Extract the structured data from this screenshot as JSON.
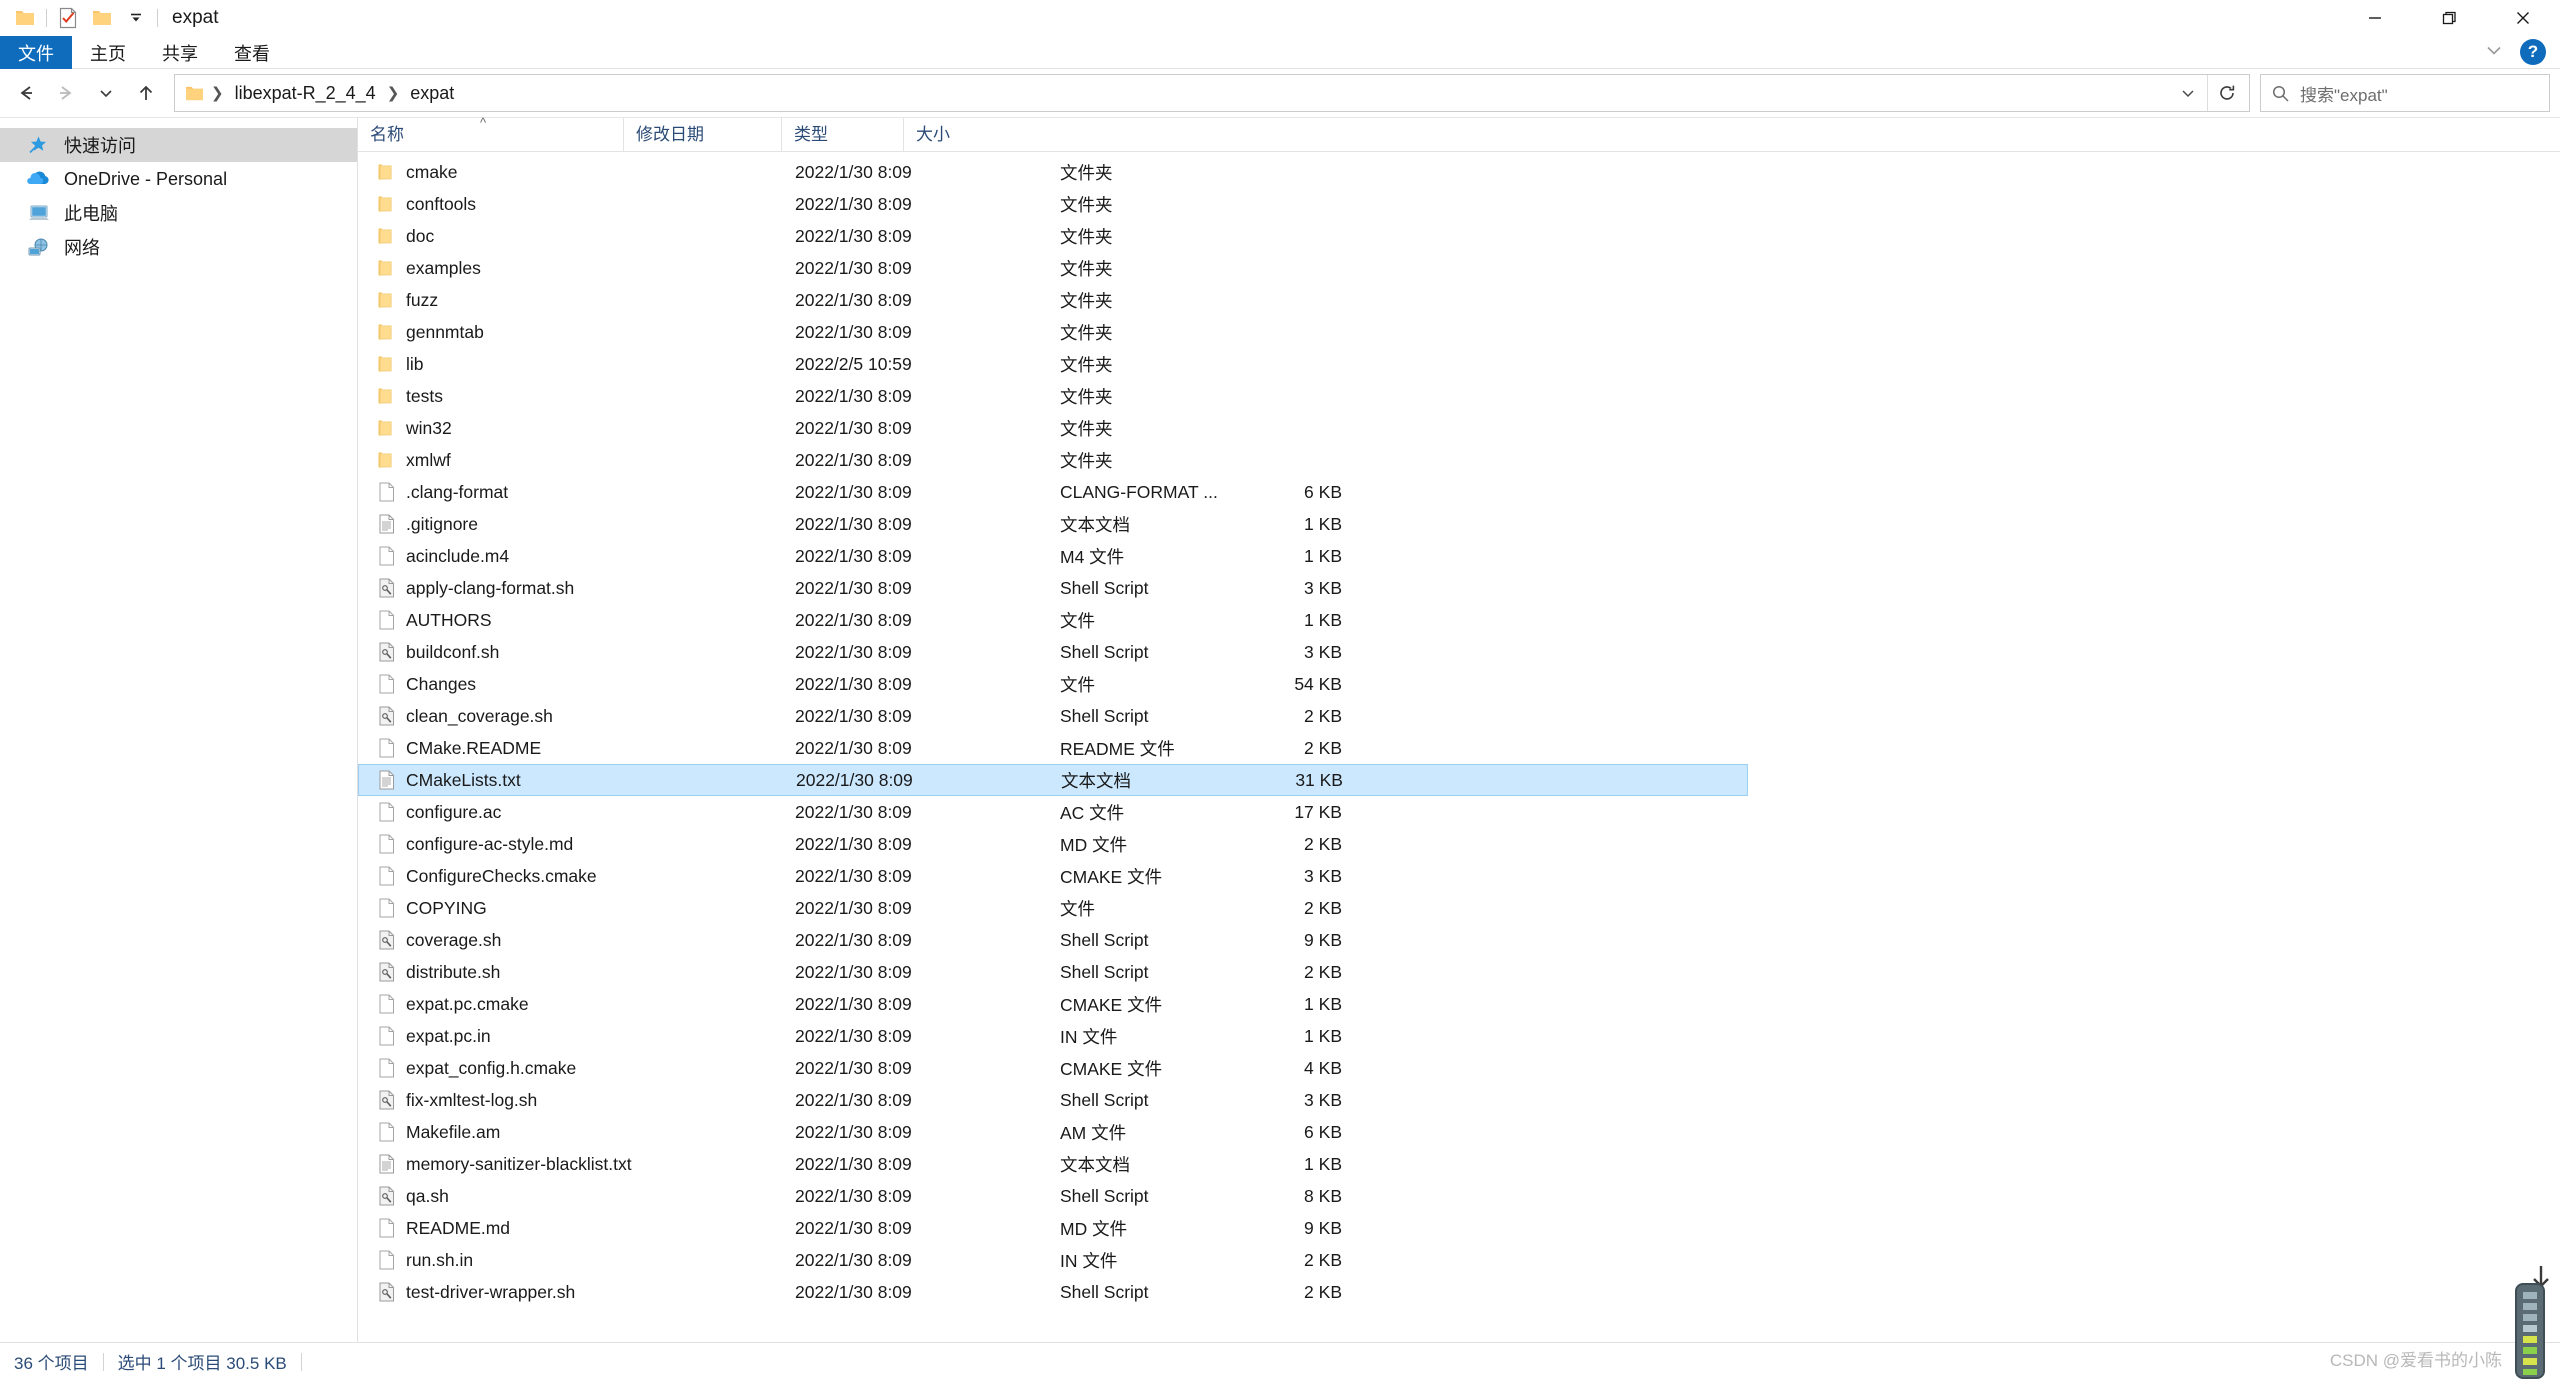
{
  "window": {
    "title": "expat",
    "quick_access": [
      "folder-icon",
      "checklist-icon",
      "folder-icon",
      "dropdown-caret"
    ],
    "controls": {
      "minimize": "minimize-icon",
      "maximize": "restore-icon",
      "close": "close-icon"
    }
  },
  "ribbon": {
    "tabs": [
      {
        "label": "文件",
        "active": true
      },
      {
        "label": "主页",
        "active": false
      },
      {
        "label": "共享",
        "active": false
      },
      {
        "label": "查看",
        "active": false
      }
    ],
    "collapse_label": "⌄",
    "help_label": "?"
  },
  "address": {
    "back": "back-arrow",
    "forward": "forward-arrow",
    "recent": "recent-chevron",
    "up": "up-arrow",
    "breadcrumbs": [
      "libexpat-R_2_4_4",
      "expat"
    ],
    "refresh": "refresh-icon"
  },
  "search": {
    "placeholder": "搜索\"expat\"",
    "icon": "search-icon"
  },
  "sidebar": {
    "items": [
      {
        "label": "快速访问",
        "icon": "pin-star-icon",
        "selected": true
      },
      {
        "label": "OneDrive - Personal",
        "icon": "onedrive-cloud-icon",
        "selected": false
      },
      {
        "label": "此电脑",
        "icon": "this-pc-icon",
        "selected": false
      },
      {
        "label": "网络",
        "icon": "network-icon",
        "selected": false
      }
    ]
  },
  "columns": [
    {
      "key": "name",
      "label": "名称",
      "sorted": "asc"
    },
    {
      "key": "date",
      "label": "修改日期",
      "sorted": ""
    },
    {
      "key": "type",
      "label": "类型",
      "sorted": ""
    },
    {
      "key": "size",
      "label": "大小",
      "sorted": ""
    }
  ],
  "files": [
    {
      "name": "cmake",
      "date": "2022/1/30 8:09",
      "type": "文件夹",
      "size": "",
      "icon": "folder-icon",
      "selected": false
    },
    {
      "name": "conftools",
      "date": "2022/1/30 8:09",
      "type": "文件夹",
      "size": "",
      "icon": "folder-icon",
      "selected": false
    },
    {
      "name": "doc",
      "date": "2022/1/30 8:09",
      "type": "文件夹",
      "size": "",
      "icon": "folder-icon",
      "selected": false
    },
    {
      "name": "examples",
      "date": "2022/1/30 8:09",
      "type": "文件夹",
      "size": "",
      "icon": "folder-icon",
      "selected": false
    },
    {
      "name": "fuzz",
      "date": "2022/1/30 8:09",
      "type": "文件夹",
      "size": "",
      "icon": "folder-icon",
      "selected": false
    },
    {
      "name": "gennmtab",
      "date": "2022/1/30 8:09",
      "type": "文件夹",
      "size": "",
      "icon": "folder-icon",
      "selected": false
    },
    {
      "name": "lib",
      "date": "2022/2/5 10:59",
      "type": "文件夹",
      "size": "",
      "icon": "folder-icon",
      "selected": false
    },
    {
      "name": "tests",
      "date": "2022/1/30 8:09",
      "type": "文件夹",
      "size": "",
      "icon": "folder-icon",
      "selected": false
    },
    {
      "name": "win32",
      "date": "2022/1/30 8:09",
      "type": "文件夹",
      "size": "",
      "icon": "folder-icon",
      "selected": false
    },
    {
      "name": "xmlwf",
      "date": "2022/1/30 8:09",
      "type": "文件夹",
      "size": "",
      "icon": "folder-icon",
      "selected": false
    },
    {
      "name": ".clang-format",
      "date": "2022/1/30 8:09",
      "type": "CLANG-FORMAT ...",
      "size": "6 KB",
      "icon": "file-icon",
      "selected": false
    },
    {
      "name": ".gitignore",
      "date": "2022/1/30 8:09",
      "type": "文本文档",
      "size": "1 KB",
      "icon": "text-icon",
      "selected": false
    },
    {
      "name": "acinclude.m4",
      "date": "2022/1/30 8:09",
      "type": "M4 文件",
      "size": "1 KB",
      "icon": "file-icon",
      "selected": false
    },
    {
      "name": "apply-clang-format.sh",
      "date": "2022/1/30 8:09",
      "type": "Shell Script",
      "size": "3 KB",
      "icon": "script-icon",
      "selected": false
    },
    {
      "name": "AUTHORS",
      "date": "2022/1/30 8:09",
      "type": "文件",
      "size": "1 KB",
      "icon": "file-icon",
      "selected": false
    },
    {
      "name": "buildconf.sh",
      "date": "2022/1/30 8:09",
      "type": "Shell Script",
      "size": "3 KB",
      "icon": "script-icon",
      "selected": false
    },
    {
      "name": "Changes",
      "date": "2022/1/30 8:09",
      "type": "文件",
      "size": "54 KB",
      "icon": "file-icon",
      "selected": false
    },
    {
      "name": "clean_coverage.sh",
      "date": "2022/1/30 8:09",
      "type": "Shell Script",
      "size": "2 KB",
      "icon": "script-icon",
      "selected": false
    },
    {
      "name": "CMake.README",
      "date": "2022/1/30 8:09",
      "type": "README 文件",
      "size": "2 KB",
      "icon": "file-icon",
      "selected": false
    },
    {
      "name": "CMakeLists.txt",
      "date": "2022/1/30 8:09",
      "type": "文本文档",
      "size": "31 KB",
      "icon": "text-icon",
      "selected": true
    },
    {
      "name": "configure.ac",
      "date": "2022/1/30 8:09",
      "type": "AC 文件",
      "size": "17 KB",
      "icon": "file-icon",
      "selected": false
    },
    {
      "name": "configure-ac-style.md",
      "date": "2022/1/30 8:09",
      "type": "MD 文件",
      "size": "2 KB",
      "icon": "file-icon",
      "selected": false
    },
    {
      "name": "ConfigureChecks.cmake",
      "date": "2022/1/30 8:09",
      "type": "CMAKE 文件",
      "size": "3 KB",
      "icon": "file-icon",
      "selected": false
    },
    {
      "name": "COPYING",
      "date": "2022/1/30 8:09",
      "type": "文件",
      "size": "2 KB",
      "icon": "file-icon",
      "selected": false
    },
    {
      "name": "coverage.sh",
      "date": "2022/1/30 8:09",
      "type": "Shell Script",
      "size": "9 KB",
      "icon": "script-icon",
      "selected": false
    },
    {
      "name": "distribute.sh",
      "date": "2022/1/30 8:09",
      "type": "Shell Script",
      "size": "2 KB",
      "icon": "script-icon",
      "selected": false
    },
    {
      "name": "expat.pc.cmake",
      "date": "2022/1/30 8:09",
      "type": "CMAKE 文件",
      "size": "1 KB",
      "icon": "file-icon",
      "selected": false
    },
    {
      "name": "expat.pc.in",
      "date": "2022/1/30 8:09",
      "type": "IN 文件",
      "size": "1 KB",
      "icon": "file-icon",
      "selected": false
    },
    {
      "name": "expat_config.h.cmake",
      "date": "2022/1/30 8:09",
      "type": "CMAKE 文件",
      "size": "4 KB",
      "icon": "file-icon",
      "selected": false
    },
    {
      "name": "fix-xmltest-log.sh",
      "date": "2022/1/30 8:09",
      "type": "Shell Script",
      "size": "3 KB",
      "icon": "script-icon",
      "selected": false
    },
    {
      "name": "Makefile.am",
      "date": "2022/1/30 8:09",
      "type": "AM 文件",
      "size": "6 KB",
      "icon": "file-icon",
      "selected": false
    },
    {
      "name": "memory-sanitizer-blacklist.txt",
      "date": "2022/1/30 8:09",
      "type": "文本文档",
      "size": "1 KB",
      "icon": "text-icon",
      "selected": false
    },
    {
      "name": "qa.sh",
      "date": "2022/1/30 8:09",
      "type": "Shell Script",
      "size": "8 KB",
      "icon": "script-icon",
      "selected": false
    },
    {
      "name": "README.md",
      "date": "2022/1/30 8:09",
      "type": "MD 文件",
      "size": "9 KB",
      "icon": "file-icon",
      "selected": false
    },
    {
      "name": "run.sh.in",
      "date": "2022/1/30 8:09",
      "type": "IN 文件",
      "size": "2 KB",
      "icon": "file-icon",
      "selected": false
    },
    {
      "name": "test-driver-wrapper.sh",
      "date": "2022/1/30 8:09",
      "type": "Shell Script",
      "size": "2 KB",
      "icon": "script-icon",
      "selected": false
    }
  ],
  "status": {
    "item_count": "36 个项目",
    "selection": "选中 1 个项目  30.5 KB",
    "watermark": "CSDN @爱看书的小陈"
  }
}
